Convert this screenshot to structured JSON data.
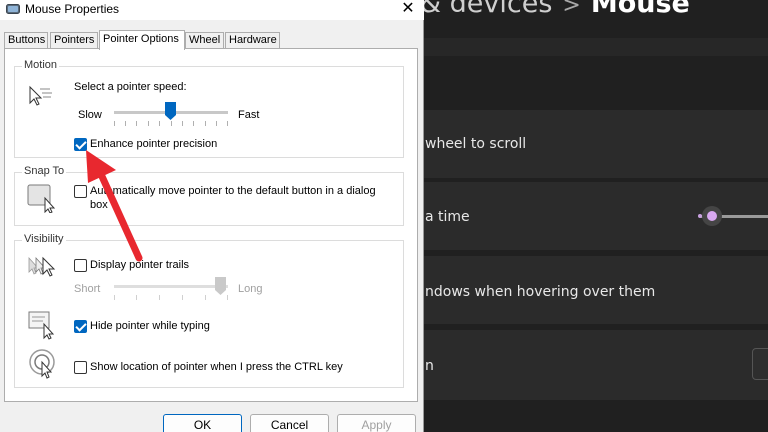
{
  "settings": {
    "breadcrumb_parent": "& devices",
    "breadcrumb_sep": ">",
    "breadcrumb_current": "Mouse",
    "row1_text": "wheel to scroll",
    "row2_text": "a time",
    "row3_text": "ndows when hovering over them",
    "row4_text": "n"
  },
  "dialog": {
    "title": "Mouse Properties",
    "tabs": [
      {
        "label": "Buttons"
      },
      {
        "label": "Pointers"
      },
      {
        "label": "Pointer Options"
      },
      {
        "label": "Wheel"
      },
      {
        "label": "Hardware"
      }
    ],
    "active_tab": "Pointer Options",
    "motion": {
      "group_label": "Motion",
      "speed_label": "Select a pointer speed:",
      "slow_label": "Slow",
      "fast_label": "Fast",
      "speed_level": 0.6,
      "enhance_label": "Enhance pointer precision",
      "enhance_checked": true
    },
    "snap_to": {
      "group_label": "Snap To",
      "auto_move_label_line1": "Automatically move pointer to the default button in a dialog",
      "auto_move_label_line2": "box",
      "auto_move_checked": false
    },
    "visibility": {
      "group_label": "Visibility",
      "trails_label": "Display pointer trails",
      "trails_checked": false,
      "short_label": "Short",
      "long_label": "Long",
      "trails_level": 1.0,
      "hide_label": "Hide pointer while typing",
      "hide_checked": true,
      "show_ctrl_label": "Show location of pointer when I press the CTRL key",
      "show_ctrl_checked": false
    },
    "buttons": {
      "ok": "OK",
      "cancel": "Cancel",
      "apply": "Apply"
    }
  },
  "colors": {
    "accent": "#0067c0",
    "annotation_arrow": "#e8282f",
    "settings_bg": "#202020",
    "settings_card": "#2b2b2b",
    "slider_accent": "#d8a8f0"
  }
}
